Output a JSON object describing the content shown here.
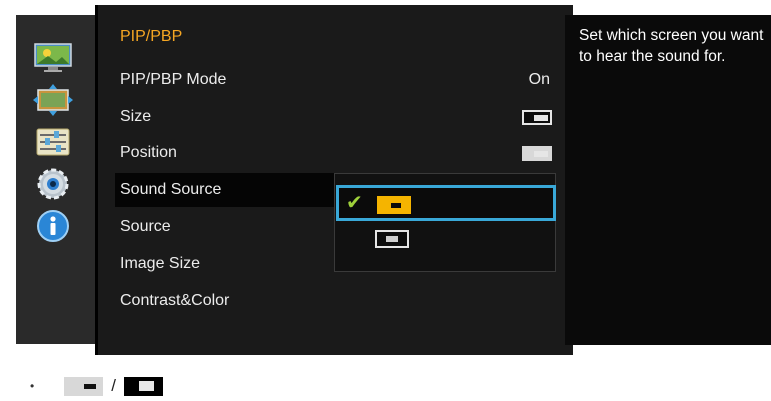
{
  "menu": {
    "title": "PIP/PBP",
    "items": [
      {
        "label": "PIP/PBP Mode",
        "value": "On"
      },
      {
        "label": "Size"
      },
      {
        "label": "Position"
      },
      {
        "label": "Sound Source"
      },
      {
        "label": "Source"
      },
      {
        "label": "Image Size"
      },
      {
        "label": "Contrast&Color"
      }
    ]
  },
  "help": {
    "text": "Set which screen you want to hear the sound for."
  },
  "legend": {
    "separator": "/"
  },
  "icons": [
    "picture-icon",
    "onscreen-display-icon",
    "settings-sliders-icon",
    "gear-icon",
    "info-icon"
  ],
  "colors": {
    "accent_title": "#f5a623",
    "selection_border": "#39a8d8",
    "check": "#9fd13b"
  }
}
